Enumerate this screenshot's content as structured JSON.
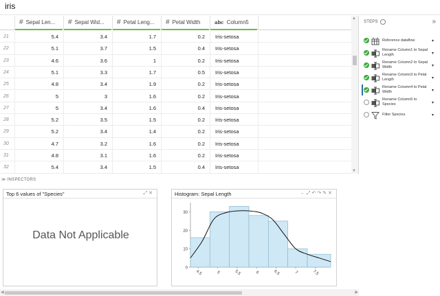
{
  "window": {
    "title": "iris"
  },
  "grid": {
    "columns": [
      {
        "type": "number",
        "label": "Sepal Len..."
      },
      {
        "type": "number",
        "label": "Sepal Wid..."
      },
      {
        "type": "number",
        "label": "Petal Leng..."
      },
      {
        "type": "number",
        "label": "Petal Width"
      },
      {
        "type": "text",
        "label": "Column5"
      }
    ],
    "rows": [
      {
        "idx": "21",
        "c1": "5.4",
        "c2": "3.4",
        "c3": "1.7",
        "c4": "0.2",
        "c5": "Iris-setosa"
      },
      {
        "idx": "22",
        "c1": "5.1",
        "c2": "3.7",
        "c3": "1.5",
        "c4": "0.4",
        "c5": "Iris-setosa"
      },
      {
        "idx": "23",
        "c1": "4.6",
        "c2": "3.6",
        "c3": "1",
        "c4": "0.2",
        "c5": "Iris-setosa"
      },
      {
        "idx": "24",
        "c1": "5.1",
        "c2": "3.3",
        "c3": "1.7",
        "c4": "0.5",
        "c5": "Iris-setosa"
      },
      {
        "idx": "25",
        "c1": "4.8",
        "c2": "3.4",
        "c3": "1.9",
        "c4": "0.2",
        "c5": "Iris-setosa"
      },
      {
        "idx": "26",
        "c1": "5",
        "c2": "3",
        "c3": "1.6",
        "c4": "0.2",
        "c5": "Iris-setosa"
      },
      {
        "idx": "27",
        "c1": "5",
        "c2": "3.4",
        "c3": "1.6",
        "c4": "0.4",
        "c5": "Iris-setosa"
      },
      {
        "idx": "28",
        "c1": "5.2",
        "c2": "3.5",
        "c3": "1.5",
        "c4": "0.2",
        "c5": "Iris-setosa"
      },
      {
        "idx": "29",
        "c1": "5.2",
        "c2": "3.4",
        "c3": "1.4",
        "c4": "0.2",
        "c5": "Iris-setosa"
      },
      {
        "idx": "30",
        "c1": "4.7",
        "c2": "3.2",
        "c3": "1.6",
        "c4": "0.2",
        "c5": "Iris-setosa"
      },
      {
        "idx": "31",
        "c1": "4.8",
        "c2": "3.1",
        "c3": "1.6",
        "c4": "0.2",
        "c5": "Iris-setosa"
      },
      {
        "idx": "32",
        "c1": "5.4",
        "c2": "3.4",
        "c3": "1.5",
        "c4": "0.4",
        "c5": "Iris-setosa"
      }
    ]
  },
  "steps": {
    "heading": "STEPS",
    "items": [
      {
        "label": "Reference dataflow",
        "status": "ok",
        "icon": "dataflow-icon"
      },
      {
        "label": "Rename Column1 to Sepal Length",
        "status": "ok",
        "icon": "rename-icon"
      },
      {
        "label": "Rename Column2 to Sepal Width",
        "status": "ok",
        "icon": "rename-icon"
      },
      {
        "label": "Rename Column3 to Petal Length",
        "status": "ok",
        "icon": "rename-icon"
      },
      {
        "label": "Rename Column4 to Petal Width",
        "status": "ok",
        "icon": "rename-icon",
        "selected": true
      },
      {
        "label": "Rename Column5 to Species",
        "status": "pending",
        "icon": "rename-icon"
      },
      {
        "label": "Filter Species",
        "status": "pending",
        "icon": "filter-icon"
      }
    ]
  },
  "inspectors": {
    "label": "INSPECTORS",
    "species_panel": {
      "title": "Top 6 values of \"Species\"",
      "message": "Data Not Applicable"
    },
    "histogram_panel": {
      "title": "Histogram: Sepal Length"
    }
  },
  "chart_data": {
    "type": "bar",
    "title": "Histogram: Sepal Length",
    "xlabel": "",
    "ylabel": "",
    "bins": [
      4.3,
      4.8,
      5.3,
      5.8,
      6.3,
      6.8,
      7.3,
      7.9
    ],
    "values": [
      16,
      30,
      33,
      28,
      25,
      10,
      7
    ],
    "xticks": [
      "4.5",
      "5",
      "5.5",
      "6",
      "6.5",
      "7",
      "7.5"
    ],
    "xtick_values": [
      4.5,
      5,
      5.5,
      6,
      6.5,
      7,
      7.5
    ],
    "yticks": [
      0,
      10,
      20,
      30
    ],
    "xlim": [
      4.3,
      7.9
    ],
    "ylim": [
      0,
      35
    ],
    "density_curve": [
      [
        4.3,
        5
      ],
      [
        4.6,
        14
      ],
      [
        4.9,
        26
      ],
      [
        5.2,
        29.5
      ],
      [
        5.5,
        30.5
      ],
      [
        5.8,
        30.5
      ],
      [
        6.1,
        29.5
      ],
      [
        6.4,
        26
      ],
      [
        6.7,
        18
      ],
      [
        7.0,
        10
      ],
      [
        7.3,
        7
      ],
      [
        7.6,
        5
      ],
      [
        7.9,
        3
      ]
    ],
    "colors": {
      "bar_fill": "#cfe8f5",
      "bar_stroke": "#8fb7cc",
      "curve": "#111111"
    }
  }
}
